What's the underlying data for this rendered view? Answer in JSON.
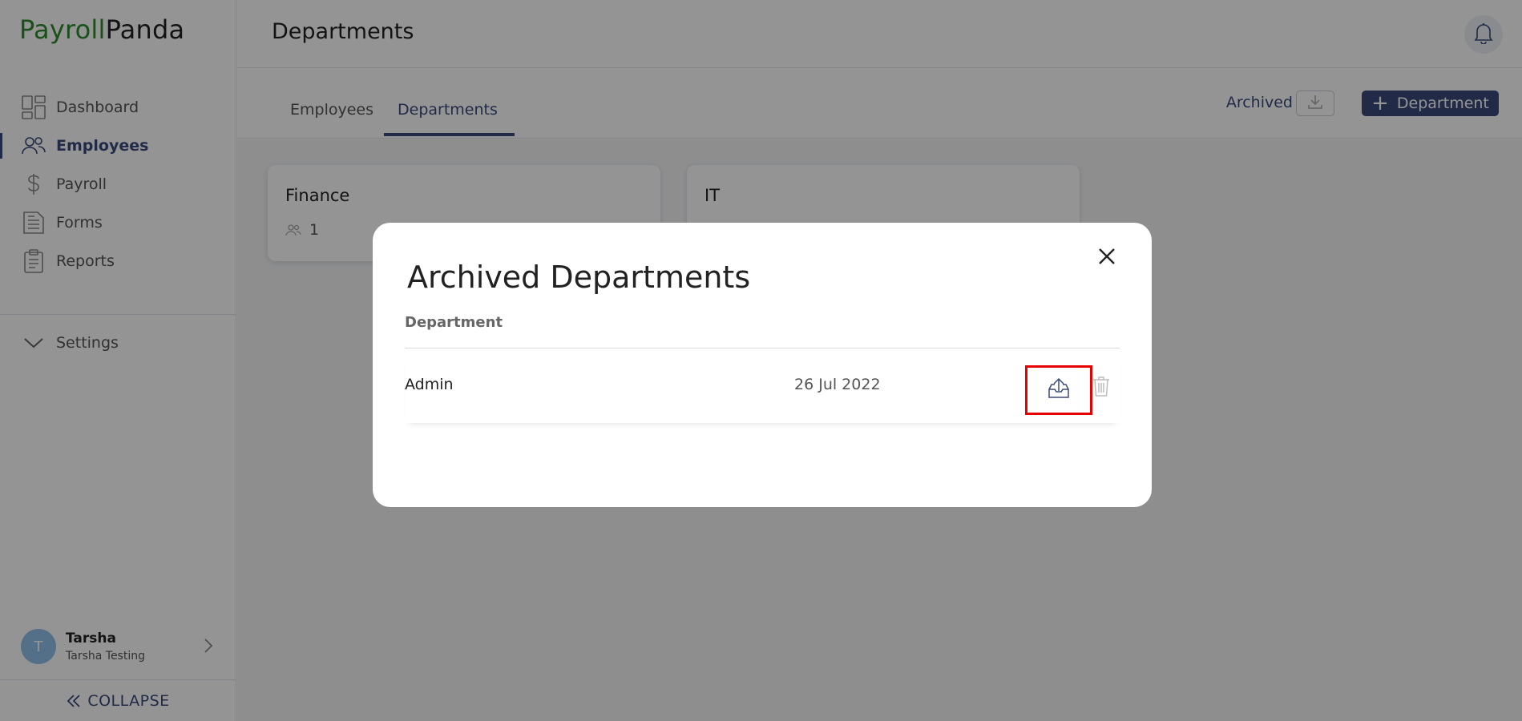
{
  "brand": {
    "part1": "Payroll",
    "part2": "Panda"
  },
  "sidebar": {
    "items": [
      {
        "label": "Dashboard",
        "icon": "dashboard-icon",
        "active": false
      },
      {
        "label": "Employees",
        "icon": "users-icon",
        "active": true
      },
      {
        "label": "Payroll",
        "icon": "dollar-icon",
        "active": false
      },
      {
        "label": "Forms",
        "icon": "document-icon",
        "active": false
      },
      {
        "label": "Reports",
        "icon": "clipboard-icon",
        "active": false
      }
    ],
    "settings_label": "Settings",
    "user": {
      "initial": "T",
      "name": "Tarsha",
      "subtitle": "Tarsha Testing"
    },
    "collapse_label": "COLLAPSE"
  },
  "header": {
    "title": "Departments",
    "notifications_icon": "bell-icon"
  },
  "tabs": [
    {
      "label": "Employees",
      "active": false
    },
    {
      "label": "Departments",
      "active": true
    }
  ],
  "toolbar": {
    "archived_label": "Archived",
    "download_icon": "download-icon",
    "add_department_label": "Department"
  },
  "departments": [
    {
      "name": "Finance",
      "count": "1"
    },
    {
      "name": "IT",
      "count": ""
    }
  ],
  "modal": {
    "title": "Archived Departments",
    "column_header": "Department",
    "rows": [
      {
        "name": "Admin",
        "date": "26 Jul 2022",
        "restore_icon": "restore-upload-icon",
        "delete_icon": "trash-icon"
      }
    ]
  },
  "colors": {
    "brand_green": "#2e8b2e",
    "primary": "#3a4a7a",
    "highlight": "#e60000",
    "avatar": "#8fc1ea"
  }
}
